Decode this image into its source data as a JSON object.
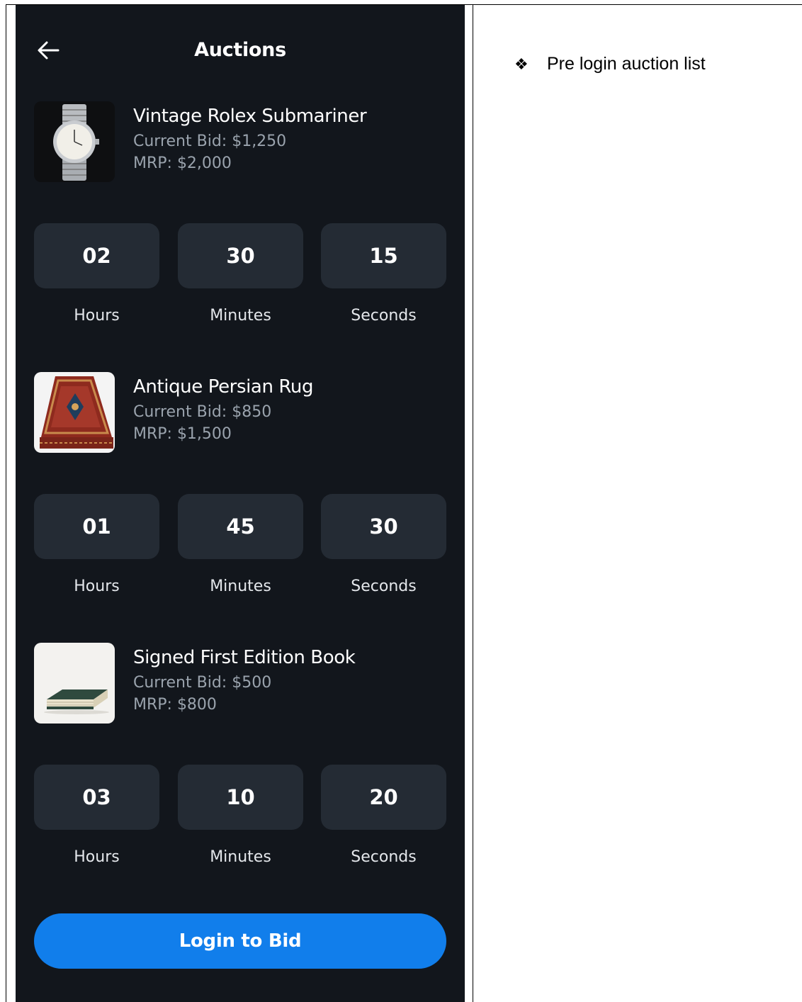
{
  "app": {
    "title": "Auctions",
    "back_icon": "arrow-left-icon",
    "accent_color": "#117eeb",
    "background_color": "#12161c",
    "timer_box_color": "#242b34"
  },
  "auctions": [
    {
      "name": "Vintage Rolex Submariner",
      "current_bid": "Current Bid: $1,250",
      "mrp": "MRP: $2,000",
      "image": "watch-image",
      "timer": {
        "hours": "02",
        "minutes": "30",
        "seconds": "15",
        "hours_label": "Hours",
        "minutes_label": "Minutes",
        "seconds_label": "Seconds"
      }
    },
    {
      "name": "Antique Persian Rug",
      "current_bid": "Current Bid: $850",
      "mrp": "MRP: $1,500",
      "image": "rug-image",
      "timer": {
        "hours": "01",
        "minutes": "45",
        "seconds": "30",
        "hours_label": "Hours",
        "minutes_label": "Minutes",
        "seconds_label": "Seconds"
      }
    },
    {
      "name": "Signed First Edition Book",
      "current_bid": "Current Bid: $500",
      "mrp": "MRP: $800",
      "image": "book-image",
      "timer": {
        "hours": "03",
        "minutes": "10",
        "seconds": "20",
        "hours_label": "Hours",
        "minutes_label": "Minutes",
        "seconds_label": "Seconds"
      }
    }
  ],
  "login_button": {
    "label": "Login to Bid"
  },
  "document_note": {
    "bullet": "❖",
    "text": "Pre login auction list"
  }
}
